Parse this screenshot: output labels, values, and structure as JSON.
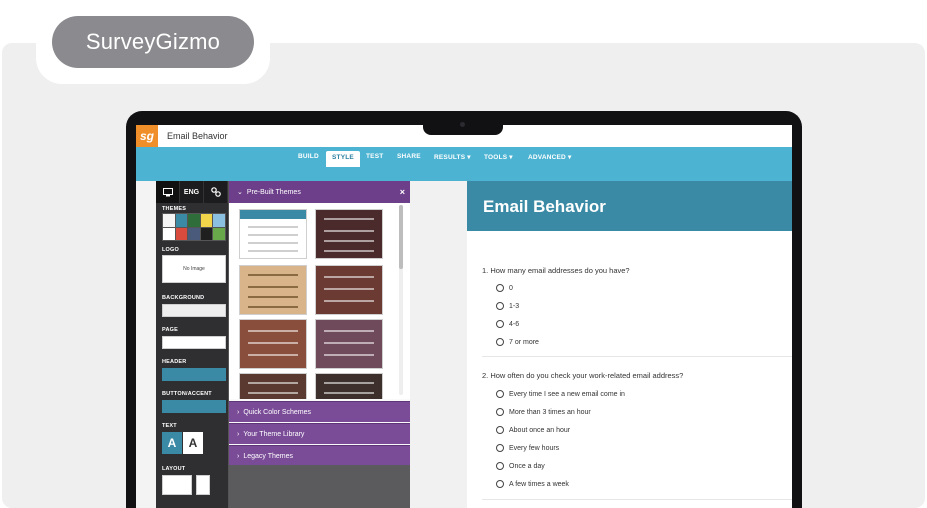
{
  "brand": {
    "name": "SurveyGizmo"
  },
  "app": {
    "logo_text": "sg",
    "survey_name": "Email Behavior"
  },
  "nav": {
    "tabs": [
      {
        "label": "BUILD"
      },
      {
        "label": "STYLE",
        "active": true
      },
      {
        "label": "TEST"
      },
      {
        "label": "SHARE"
      },
      {
        "label": "RESULTS ▾"
      },
      {
        "label": "TOOLS ▾"
      },
      {
        "label": "ADVANCED ▾"
      }
    ]
  },
  "sidebar": {
    "tabs": [
      {
        "icon": "desktop-icon",
        "label": ""
      },
      {
        "icon": "language-icon",
        "label": "ENG"
      },
      {
        "icon": "link-icon",
        "label": ""
      }
    ],
    "sections": {
      "themes": "THEMES",
      "logo": "LOGO",
      "logo_placeholder": "No Image",
      "background": "BACKGROUND",
      "page": "PAGE",
      "header": "HEADER",
      "button_accent": "BUTTON/ACCENT",
      "text": "TEXT",
      "layout": "LAYOUT"
    },
    "text_swatches": [
      "A",
      "A"
    ],
    "colors": {
      "header": "#3b8aa5",
      "button_accent": "#3b8aa5",
      "background": "#eeeeee",
      "page": "#ffffff"
    }
  },
  "theme_panel": {
    "title": "Pre-Built Themes",
    "close": "×",
    "accordion": [
      {
        "label": "Quick Color Schemes"
      },
      {
        "label": "Your Theme Library"
      },
      {
        "label": "Legacy Themes"
      }
    ],
    "thumb_colors": [
      "#ffffff",
      "#4a2a2a",
      "#d9b48a",
      "#6b3a33",
      "#8a4e3c",
      "#6f4a5a",
      "#5a3a30",
      "#3c2f2c"
    ]
  },
  "preview": {
    "title": "Email Behavior",
    "questions": [
      {
        "text": "1. How many email addresses do you have?",
        "options": [
          "0",
          "1-3",
          "4-6",
          "7 or more"
        ]
      },
      {
        "text": "2. How often do you check your work-related email address?",
        "options": [
          "Every time I see a new email come in",
          "More than 3 times an hour",
          "About once an hour",
          "Every few hours",
          "Once a day",
          "A few times a week"
        ]
      }
    ]
  },
  "colors": {
    "accent_blue": "#4db3d2",
    "header_teal": "#3b8aa5",
    "panel_purple": "#6d3f8a",
    "logo_orange": "#f08e2a"
  }
}
